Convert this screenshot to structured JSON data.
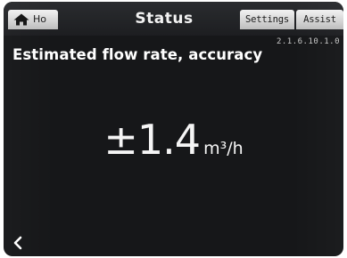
{
  "header": {
    "title": "Status",
    "tabs": {
      "home": {
        "label": "Ho",
        "icon": "home-icon"
      },
      "settings": {
        "label": "Settings"
      },
      "assist": {
        "label": "Assist"
      }
    }
  },
  "menu_code": "2.1.6.10.1.0",
  "main": {
    "heading": "Estimated flow rate, accuracy",
    "value": "±1.4",
    "unit": "m³/h"
  },
  "footer": {
    "back_icon": "chevron-left-icon"
  },
  "colors": {
    "background": "#161719",
    "text": "#f5f5f5",
    "tab": "#d9d9d9"
  }
}
